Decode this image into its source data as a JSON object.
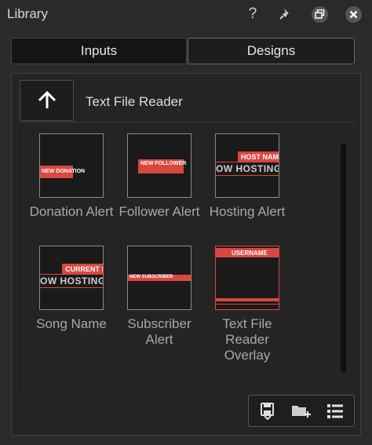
{
  "window": {
    "title": "Library",
    "help_label": "?"
  },
  "tabs": [
    {
      "label": "Inputs",
      "selected": true
    },
    {
      "label": "Designs",
      "selected": false
    }
  ],
  "browser": {
    "path_title": "Text File Reader"
  },
  "items": [
    {
      "label": "Donation Alert",
      "thumb_text": "NEW DONATION"
    },
    {
      "label": "Follower Alert",
      "thumb_text": "NEW FOLLOWER"
    },
    {
      "label": "Hosting Alert",
      "thumb_text": "HOST NAME",
      "thumb_big": "OW HOSTING Y"
    },
    {
      "label": "Song Name",
      "thumb_text": "CURRENT S",
      "thumb_big": "OW HOSTING Y"
    },
    {
      "label": "Subscriber Alert",
      "thumb_text": "NEW SUBSCRIBER"
    },
    {
      "label": "Text File Reader Overlay",
      "thumb_text": "USERNAME"
    }
  ],
  "icons": {
    "help": "question-icon",
    "pin": "pin-icon",
    "restore": "restore-window-icon",
    "close": "close-icon",
    "up": "arrow-up-icon",
    "save": "save-icon",
    "new_folder": "new-folder-icon",
    "list_view": "list-view-icon"
  },
  "colors": {
    "accent": "#d9473f",
    "background": "#2b2b2b"
  }
}
